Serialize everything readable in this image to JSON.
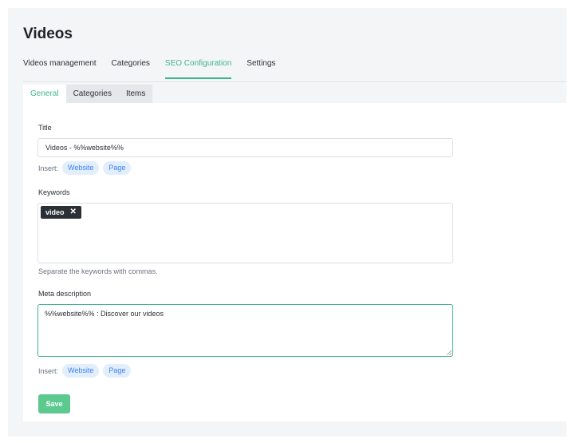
{
  "page": {
    "title": "Videos"
  },
  "main_tabs": [
    {
      "label": "Videos management",
      "active": false
    },
    {
      "label": "Categories",
      "active": false
    },
    {
      "label": "SEO Configuration",
      "active": true
    },
    {
      "label": "Settings",
      "active": false
    }
  ],
  "sub_tabs": [
    {
      "label": "General",
      "active": true
    },
    {
      "label": "Categories",
      "active": false
    },
    {
      "label": "Items",
      "active": false
    }
  ],
  "form": {
    "title": {
      "label": "Title",
      "value": "Videos - %%website%%",
      "insert_label": "Insert:",
      "chips": [
        "Website",
        "Page"
      ]
    },
    "keywords": {
      "label": "Keywords",
      "tags": [
        "video"
      ],
      "tag_remove_glyph": "✕",
      "hint": "Separate the keywords with commas."
    },
    "meta_description": {
      "label": "Meta description",
      "value": "%%website%% : Discover our videos",
      "insert_label": "Insert:",
      "chips": [
        "Website",
        "Page"
      ]
    },
    "save_label": "Save"
  },
  "colors": {
    "accent": "#3fb58a",
    "save_button": "#5cc98f",
    "chip_bg": "#e2eefc",
    "chip_text": "#3b82f6",
    "tag_bg": "#2b2f36"
  }
}
